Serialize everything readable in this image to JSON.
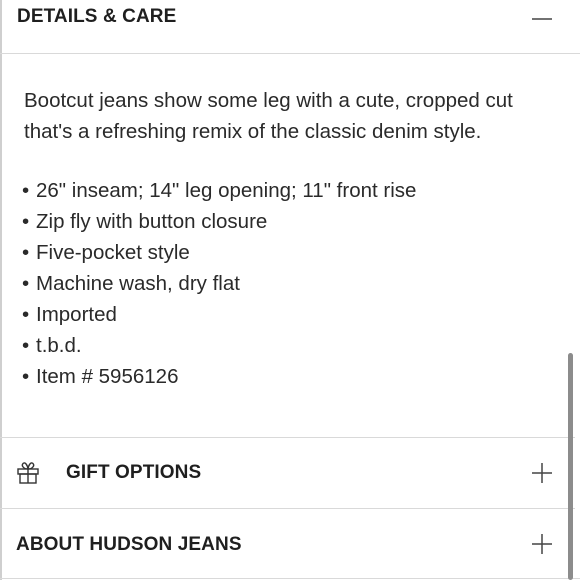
{
  "details": {
    "title": "DETAILS & CARE",
    "toggle_icon": "minus-icon",
    "description_line1": "Bootcut jeans show some leg with a cute, cropped cut",
    "description_line2": "that's a refreshing remix of the classic denim style.",
    "features": [
      "26\" inseam; 14\" leg opening; 11\" front rise",
      "Zip fly with button closure",
      "Five-pocket style",
      "Machine wash, dry flat",
      "Imported",
      "t.b.d.",
      "Item # 5956126"
    ],
    "bullet": "•"
  },
  "gift_options": {
    "title": "GIFT OPTIONS",
    "icon": "gift-icon",
    "toggle_icon": "plus-icon"
  },
  "about_brand": {
    "title": "ABOUT HUDSON JEANS",
    "toggle_icon": "plus-icon"
  },
  "colors": {
    "text": "#222222",
    "divider": "#d9d9d9",
    "scrollbar": "#8c8c8c"
  }
}
